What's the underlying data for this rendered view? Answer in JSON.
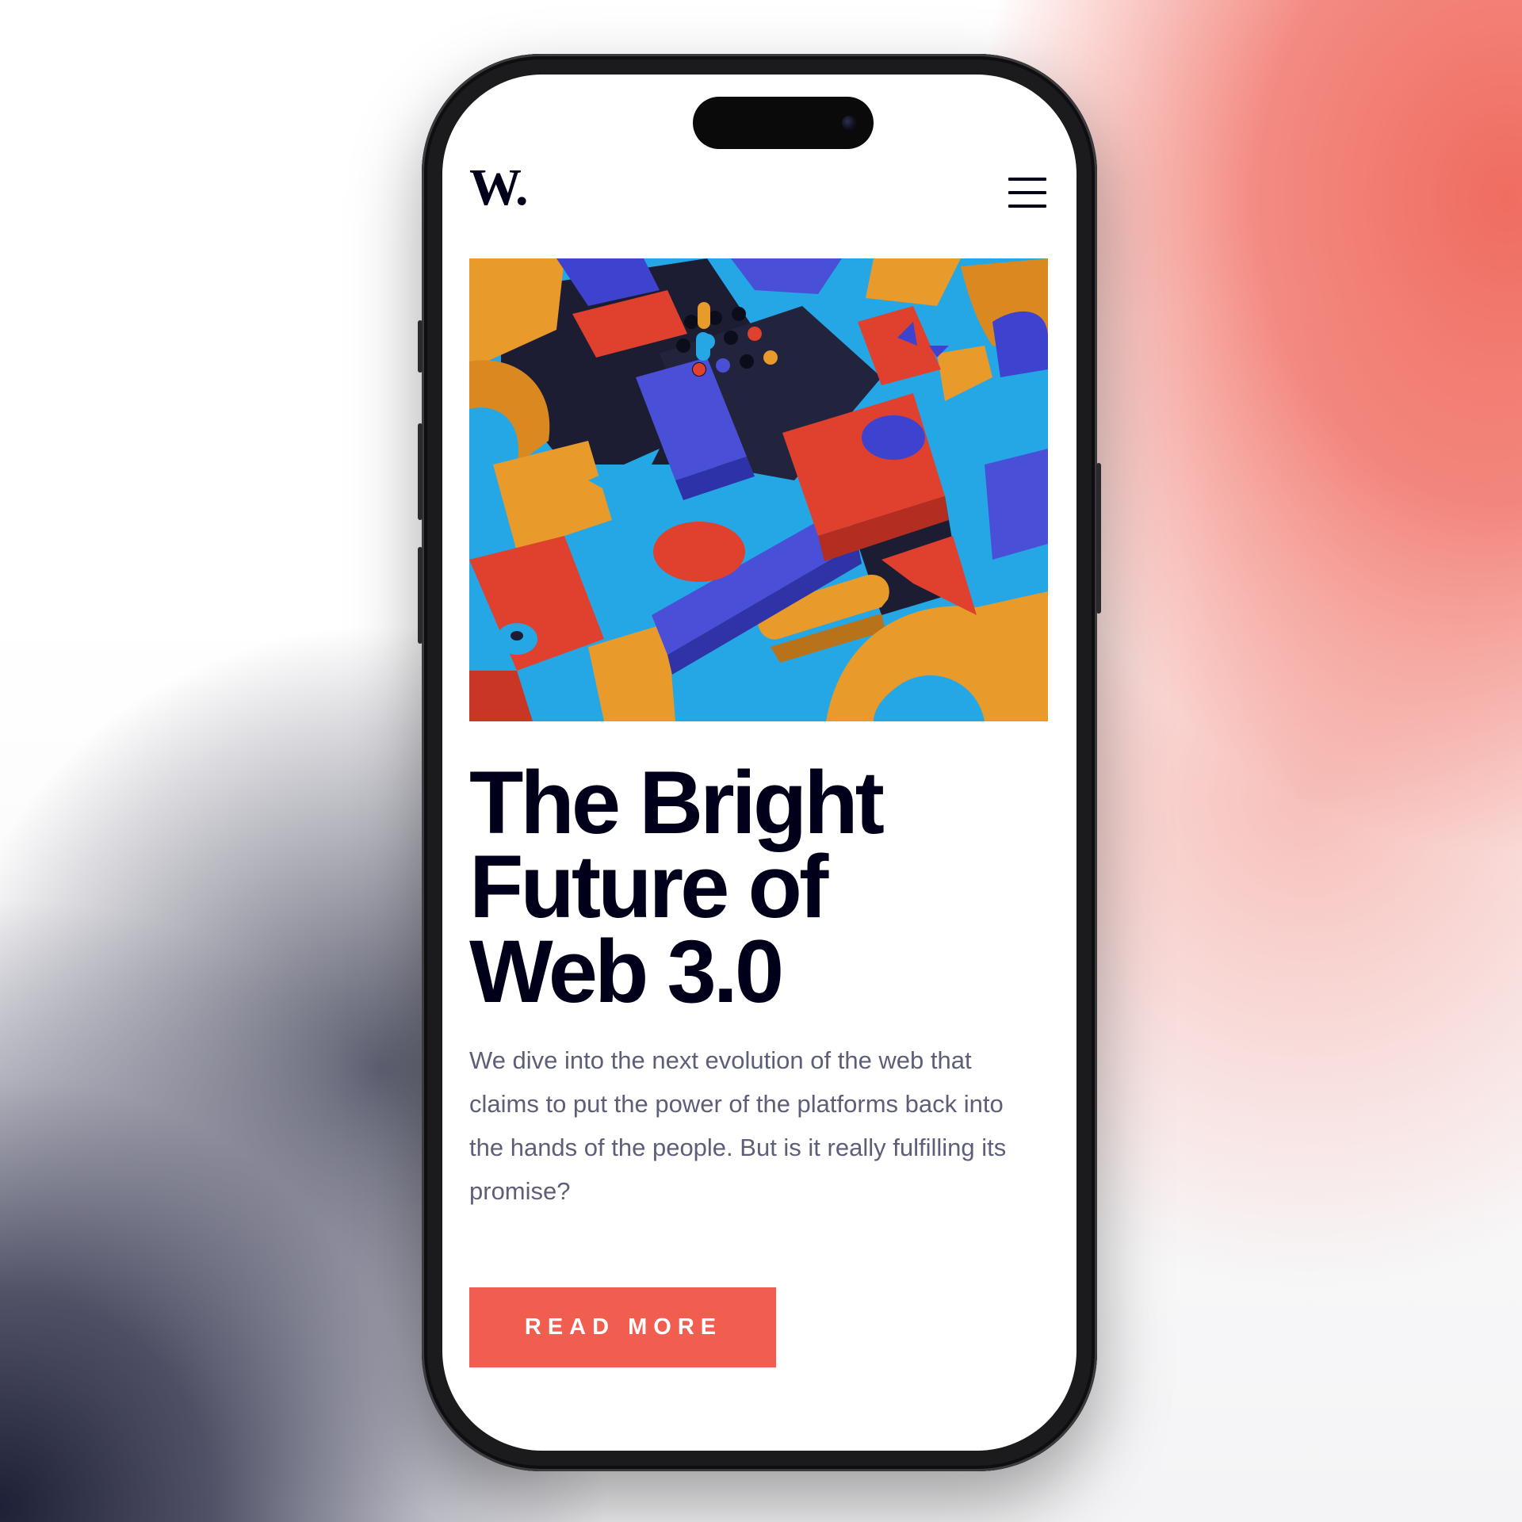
{
  "header": {
    "logo": "W.",
    "menu_icon": "hamburger-menu-icon"
  },
  "hero": {
    "image_description_icon": "abstract-3d-shapes-image",
    "colors": {
      "orange": "#e89a2a",
      "red": "#e0402e",
      "blue": "#4a4fd8",
      "cyan": "#25a7e6",
      "navy": "#1c1d33"
    }
  },
  "article": {
    "title": "The Bright Future of Web 3.0",
    "title_lines": [
      "The Bright",
      "Future of",
      "Web 3.0"
    ],
    "description": "We dive into the next evolution of the web that claims to put the power of the platforms back into the hands of the people. But is it really fulfilling its promise?",
    "cta_label": "READ MORE"
  },
  "theme": {
    "accent": "#f15e50",
    "text_dark": "#00001a",
    "text_muted": "#5d5f79"
  }
}
